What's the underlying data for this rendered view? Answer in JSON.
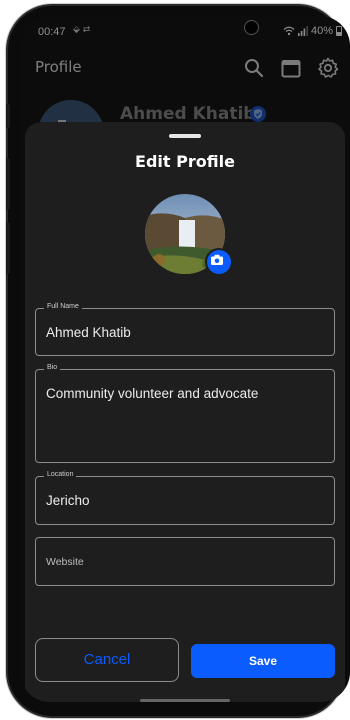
{
  "status_bar": {
    "time": "00:47",
    "notif_icons": "⬙ ⇄",
    "battery_text": "40%"
  },
  "app_bar": {
    "title": "Profile",
    "icons": [
      "search-icon",
      "calendar-icon",
      "gear-icon"
    ]
  },
  "profile": {
    "name": "Ahmed Khatib",
    "verified": true
  },
  "edit_sheet": {
    "title": "Edit Profile",
    "fields": {
      "full_name": {
        "label": "Full Name",
        "value": "Ahmed Khatib"
      },
      "bio": {
        "label": "Bio",
        "value": "Community volunteer and advocate"
      },
      "location": {
        "label": "Location",
        "value": "Jericho"
      },
      "website": {
        "placeholder": "Website"
      }
    },
    "cancel_label": "Cancel",
    "save_label": "Save"
  },
  "colors": {
    "accent": "#0a5cff",
    "sheet_bg": "#1e1e1e",
    "screen_bg": "#161616"
  }
}
